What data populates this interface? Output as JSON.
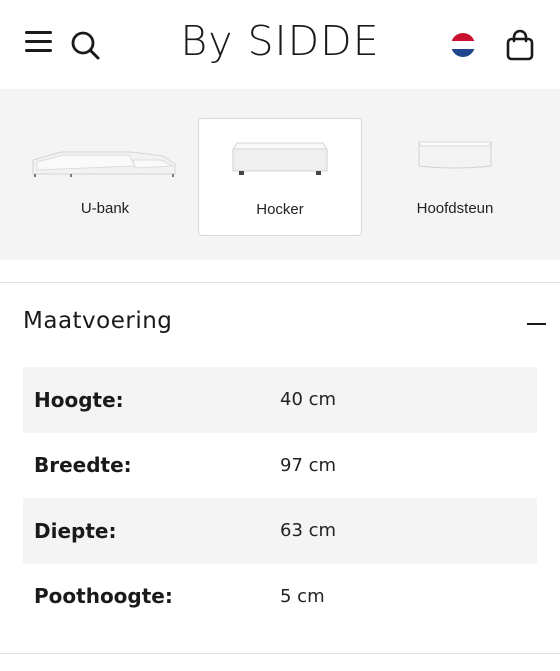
{
  "header": {
    "logo": "By SIDDE",
    "menu_icon": "hamburger-menu-icon",
    "search_icon": "search-icon",
    "language_flag": "netherlands-flag-icon",
    "cart_icon": "shopping-bag-icon"
  },
  "variants": [
    {
      "label": "U-bank",
      "selected": false
    },
    {
      "label": "Hocker",
      "selected": true
    },
    {
      "label": "Hoofdsteun",
      "selected": false
    }
  ],
  "dimensions": {
    "title": "Maatvoering",
    "toggle_icon": "minus-icon",
    "rows": [
      {
        "key": "Hoogte:",
        "value": "40 cm"
      },
      {
        "key": "Breedte:",
        "value": "97 cm"
      },
      {
        "key": "Diepte:",
        "value": "63 cm"
      },
      {
        "key": "Poothoogte:",
        "value": "5 cm"
      }
    ]
  },
  "colors": {
    "panel_bg": "#f4f4f4",
    "text": "#1a1a1a",
    "flag_red": "#c8102e",
    "flag_blue": "#21468b"
  }
}
